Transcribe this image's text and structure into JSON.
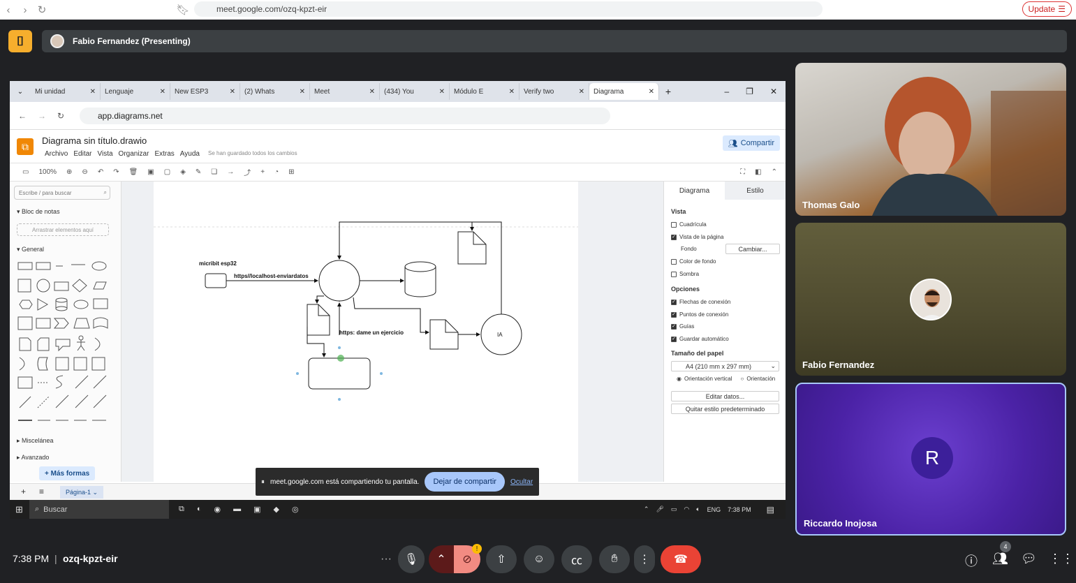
{
  "host_browser": {
    "url": "meet.google.com/ozq-kpzt-eir",
    "update_label": "Update"
  },
  "presenting": {
    "label": "Fabio Fernandez (Presenting)"
  },
  "shared_screen": {
    "tabs": [
      {
        "label": "Mi unidad"
      },
      {
        "label": "Lenguaje"
      },
      {
        "label": "New ESP3"
      },
      {
        "label": "(2) Whats"
      },
      {
        "label": "Meet"
      },
      {
        "label": "(434) You"
      },
      {
        "label": "Módulo E"
      },
      {
        "label": "Verify two"
      },
      {
        "label": "Diagrama"
      }
    ],
    "url": "app.diagrams.net",
    "drawio": {
      "title": "Diagrama sin título.drawio",
      "menu": [
        "Archivo",
        "Editar",
        "Vista",
        "Organizar",
        "Extras",
        "Ayuda"
      ],
      "saved_status": "Se han guardado todos los cambios",
      "share_label": "Compartir",
      "zoom": "100%",
      "search_placeholder": "Escribe / para buscar",
      "scratchpad": "Bloc de notas",
      "drag_here": "Arrastrar elementos aquí",
      "general": "General",
      "misc": "Miscelánea",
      "advanced": "Avanzado",
      "more_shapes": "+ Más formas",
      "diagram_labels": {
        "device": "micribit esp32",
        "edge1": "https//localhost-enviardatos",
        "edge2": "https: dame un ejercicio",
        "ia": "IA"
      },
      "right_panel": {
        "tab_diagram": "Diagrama",
        "tab_style": "Estilo",
        "view": "Vista",
        "grid": "Cuadrícula",
        "page_view": "Vista de la página",
        "background": "Fondo",
        "change": "Cambiar...",
        "bg_color": "Color de fondo",
        "shadow": "Sombra",
        "options": "Opciones",
        "conn_arrows": "Flechas de conexión",
        "conn_points": "Puntos de conexión",
        "guides": "Guías",
        "autosave": "Guardar automático",
        "paper_size": "Tamaño del papel",
        "paper_value": "A4 (210 mm x 297 mm)",
        "portrait": "Orientación vertical",
        "landscape": "Orientación",
        "edit_data": "Editar datos...",
        "remove_style": "Quitar estilo predeterminado"
      },
      "page_tab": "Página-1"
    },
    "share_banner": {
      "text": "meet.google.com está compartiendo tu pantalla.",
      "stop": "Dejar de compartir",
      "hide": "Ocultar"
    },
    "taskbar": {
      "search": "Buscar",
      "lang": "ENG",
      "time": "7:38 PM"
    }
  },
  "participants": [
    {
      "name": "Thomas Galo"
    },
    {
      "name": "Fabio Fernandez"
    },
    {
      "name": "Riccardo Inojosa",
      "initial": "R"
    }
  ],
  "meet_bar": {
    "time": "7:38 PM",
    "code": "ozq-kpzt-eir",
    "participant_count": "4"
  }
}
